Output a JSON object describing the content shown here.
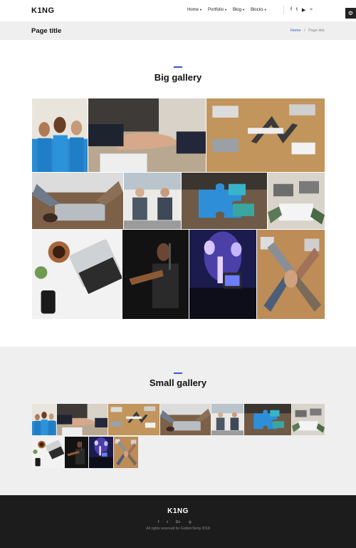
{
  "header": {
    "logo": "K1NG",
    "nav": [
      {
        "label": "Home"
      },
      {
        "label": "Portfolio"
      },
      {
        "label": "Blog"
      },
      {
        "label": "Blocks"
      }
    ],
    "social_icons": [
      "facebook-icon",
      "twitter-icon",
      "youtube-icon",
      "search-icon"
    ],
    "social_glyphs": [
      "f",
      "t",
      "▶",
      "⌕"
    ],
    "settings_glyph": "⚙"
  },
  "titlebar": {
    "title": "Page title",
    "breadcrumb": {
      "home": "Home",
      "sep": "/",
      "current": "Page title"
    }
  },
  "big_gallery": {
    "title": "Big gallery",
    "images": [
      "volunteers",
      "handshake",
      "team-meeting-desk",
      "laptop-meeting",
      "office-people",
      "puzzle-pieces",
      "team-laptops",
      "laptop-phone-desk",
      "guitar-singer",
      "concert-stage",
      "hands-stacked"
    ]
  },
  "small_gallery": {
    "title": "Small gallery",
    "images": [
      "volunteers",
      "handshake",
      "team-meeting-desk",
      "laptop-meeting",
      "office-people",
      "puzzle-pieces",
      "team-laptops",
      "laptop-phone-desk",
      "guitar-singer",
      "concert-stage",
      "hands-stacked"
    ]
  },
  "footer": {
    "logo": "K1NG",
    "social_glyphs": [
      "f",
      "t",
      "G+",
      "◎"
    ],
    "copyright": "All rights reserved for GoldenTemp 2018"
  },
  "colors": {
    "accent": "#3a56c8",
    "footer_bg": "#1c1c1c",
    "gray_bg": "#efefef"
  }
}
